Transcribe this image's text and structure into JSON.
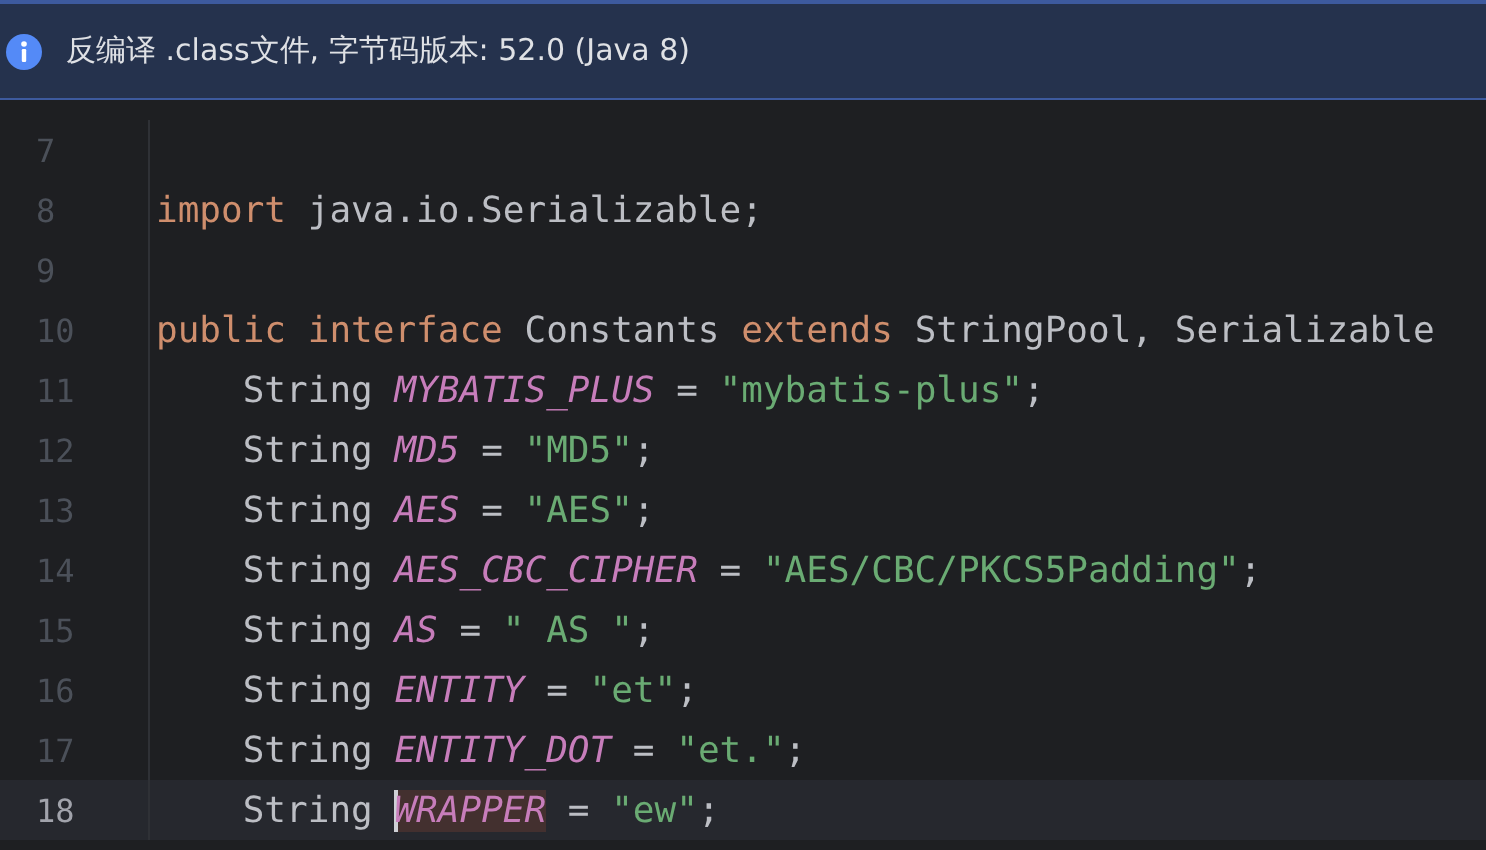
{
  "banner": {
    "message": "反编译 .class文件, 字节码版本: 52.0 (Java 8)"
  },
  "editor": {
    "lines": [
      {
        "number": "7",
        "current": false
      },
      {
        "number": "8",
        "current": false,
        "tokens": [
          {
            "kind": "keyword",
            "text": "import ",
            "marked": false
          },
          {
            "kind": "plain",
            "text": "java.io.Serializable;",
            "marked": false
          }
        ]
      },
      {
        "number": "9",
        "current": false
      },
      {
        "number": "10",
        "current": false,
        "tokens": [
          {
            "kind": "keyword",
            "text": "public interface ",
            "marked": false
          },
          {
            "kind": "plain",
            "text": "Constants ",
            "marked": false
          },
          {
            "kind": "keyword",
            "text": "extends ",
            "marked": false
          },
          {
            "kind": "plain",
            "text": "StringPool, Serializable",
            "marked": false
          }
        ]
      },
      {
        "number": "11",
        "current": false,
        "tokens": [
          {
            "kind": "plain",
            "text": "    String ",
            "marked": false
          },
          {
            "kind": "constant",
            "text": "MYBATIS_PLUS",
            "marked": false
          },
          {
            "kind": "plain",
            "text": " = ",
            "marked": false
          },
          {
            "kind": "string",
            "text": "\"mybatis-plus\"",
            "marked": false
          },
          {
            "kind": "plain",
            "text": ";",
            "marked": false
          }
        ]
      },
      {
        "number": "12",
        "current": false,
        "tokens": [
          {
            "kind": "plain",
            "text": "    String ",
            "marked": false
          },
          {
            "kind": "constant",
            "text": "MD5",
            "marked": false
          },
          {
            "kind": "plain",
            "text": " = ",
            "marked": false
          },
          {
            "kind": "string",
            "text": "\"MD5\"",
            "marked": false
          },
          {
            "kind": "plain",
            "text": ";",
            "marked": false
          }
        ]
      },
      {
        "number": "13",
        "current": false,
        "tokens": [
          {
            "kind": "plain",
            "text": "    String ",
            "marked": false
          },
          {
            "kind": "constant",
            "text": "AES",
            "marked": false
          },
          {
            "kind": "plain",
            "text": " = ",
            "marked": false
          },
          {
            "kind": "string",
            "text": "\"AES\"",
            "marked": false
          },
          {
            "kind": "plain",
            "text": ";",
            "marked": false
          }
        ]
      },
      {
        "number": "14",
        "current": false,
        "tokens": [
          {
            "kind": "plain",
            "text": "    String ",
            "marked": false
          },
          {
            "kind": "constant",
            "text": "AES_CBC_CIPHER",
            "marked": false
          },
          {
            "kind": "plain",
            "text": " = ",
            "marked": false
          },
          {
            "kind": "string",
            "text": "\"AES/CBC/PKCS5Padding\"",
            "marked": false
          },
          {
            "kind": "plain",
            "text": ";",
            "marked": false
          }
        ]
      },
      {
        "number": "15",
        "current": false,
        "tokens": [
          {
            "kind": "plain",
            "text": "    String ",
            "marked": false
          },
          {
            "kind": "constant",
            "text": "AS",
            "marked": false
          },
          {
            "kind": "plain",
            "text": " = ",
            "marked": false
          },
          {
            "kind": "string",
            "text": "\" AS \"",
            "marked": false
          },
          {
            "kind": "plain",
            "text": ";",
            "marked": false
          }
        ]
      },
      {
        "number": "16",
        "current": false,
        "tokens": [
          {
            "kind": "plain",
            "text": "    String ",
            "marked": false
          },
          {
            "kind": "constant",
            "text": "ENTITY",
            "marked": false
          },
          {
            "kind": "plain",
            "text": " = ",
            "marked": false
          },
          {
            "kind": "string",
            "text": "\"et\"",
            "marked": false
          },
          {
            "kind": "plain",
            "text": ";",
            "marked": false
          }
        ]
      },
      {
        "number": "17",
        "current": false,
        "tokens": [
          {
            "kind": "plain",
            "text": "    String ",
            "marked": false
          },
          {
            "kind": "constant",
            "text": "ENTITY_DOT",
            "marked": false
          },
          {
            "kind": "plain",
            "text": " = ",
            "marked": false
          },
          {
            "kind": "string",
            "text": "\"et.\"",
            "marked": false
          },
          {
            "kind": "plain",
            "text": ";",
            "marked": false
          }
        ]
      },
      {
        "number": "18",
        "current": true,
        "tokens": [
          {
            "kind": "plain",
            "text": "    String ",
            "marked": false
          },
          {
            "kind": "constant",
            "text": "WRAPPER",
            "marked": true
          },
          {
            "kind": "plain",
            "text": " = ",
            "marked": false
          },
          {
            "kind": "string",
            "text": "\"ew\"",
            "marked": false
          },
          {
            "kind": "plain",
            "text": ";",
            "marked": false
          }
        ]
      }
    ]
  }
}
